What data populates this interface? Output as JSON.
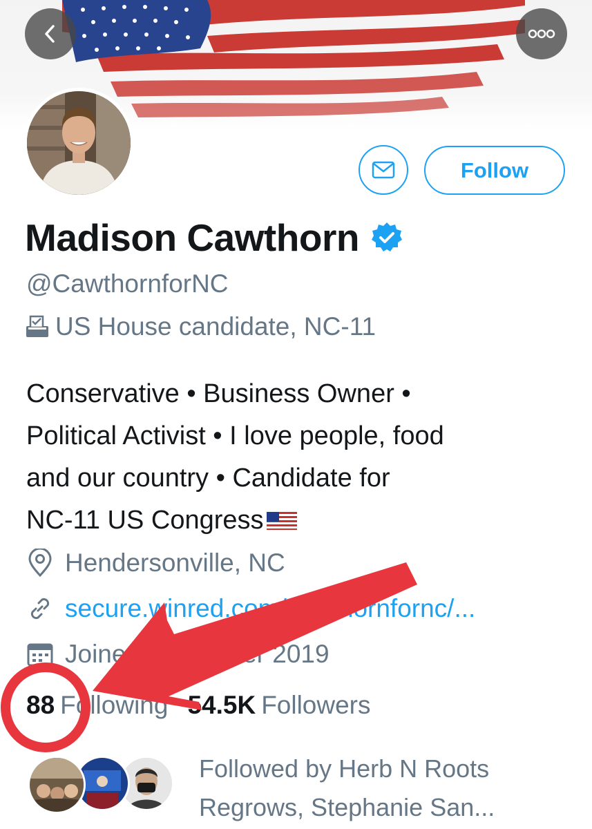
{
  "nav": {
    "back_icon": "chevron-left-icon",
    "more_icon": "more-dots-icon"
  },
  "profile": {
    "name": "Madison Cawthorn",
    "handle": "@CawthornforNC",
    "category": "US House candidate, NC-11",
    "bio": "Conservative • Business Owner •\nPolitical Activist • I love people, food\nand our country • Candidate for\nNC-11 US Congress",
    "location": "Hendersonville, NC",
    "website": "secure.winred.com/cawthornfornc/...",
    "joined": "Joined December 2019"
  },
  "actions": {
    "follow_label": "Follow",
    "message_icon": "envelope-icon"
  },
  "stats": {
    "following_count": "88",
    "following_label": "Following",
    "followers_count": "54.5K",
    "followers_label": "Followers"
  },
  "followed_by": "Followed by Herb N Roots Regrows, Stephanie San...",
  "colors": {
    "accent": "#1da1f2",
    "secondary_text": "#657786",
    "annotation_red": "#e8363f"
  }
}
